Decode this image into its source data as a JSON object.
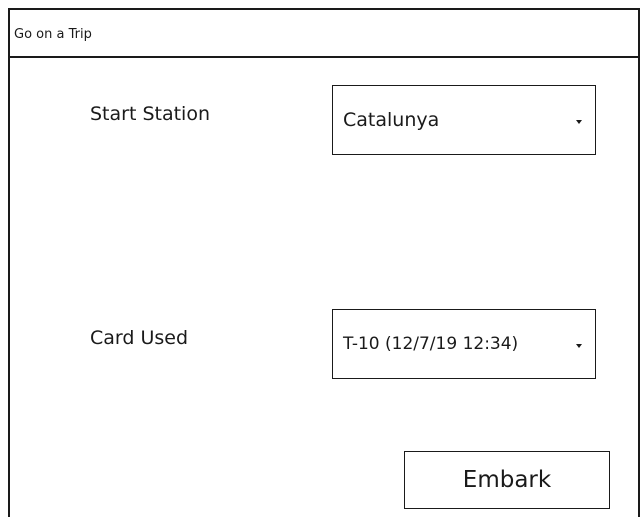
{
  "window": {
    "title": "Go on a Trip"
  },
  "form": {
    "start_station": {
      "label": "Start Station",
      "selected": "Catalunya"
    },
    "card_used": {
      "label": "Card Used",
      "selected": "T-10 (12/7/19 12:34)"
    },
    "embark_label": "Embark"
  },
  "icons": {
    "dropdown": "chevron-down-icon"
  }
}
